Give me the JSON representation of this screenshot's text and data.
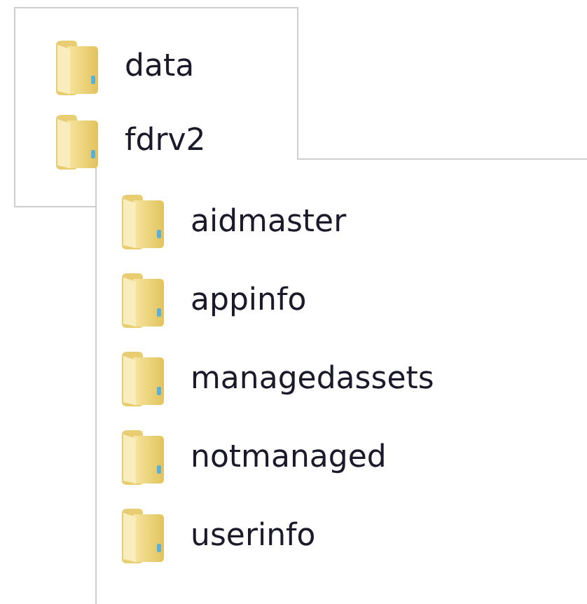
{
  "folders": [
    {
      "name": "data"
    },
    {
      "name": "fdrv2",
      "children": [
        {
          "name": "aidmaster"
        },
        {
          "name": "appinfo"
        },
        {
          "name": "managedassets"
        },
        {
          "name": "notmanaged"
        },
        {
          "name": "userinfo"
        }
      ]
    }
  ]
}
